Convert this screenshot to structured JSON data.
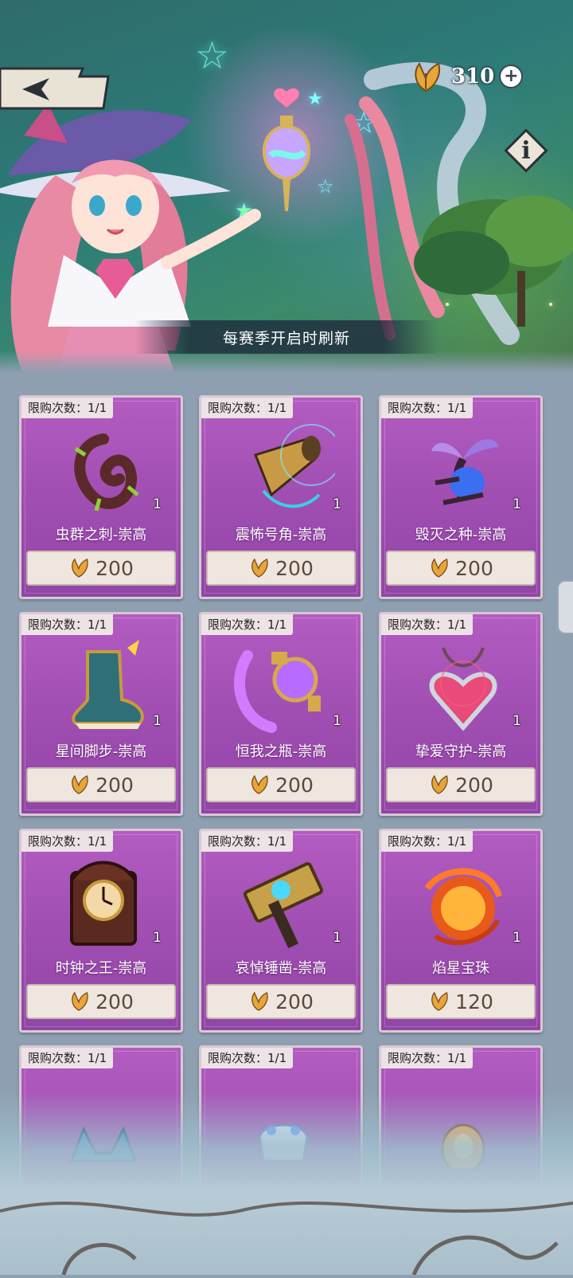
{
  "header": {
    "currency_amount": "310",
    "plus_label": "+",
    "info_label": "i",
    "refresh_note": "每赛季开启时刷新"
  },
  "colors": {
    "card_bg": "#a04eb2",
    "price_bg": "#efe6e0",
    "price_text": "#5a4a3b"
  },
  "shop": {
    "items": [
      {
        "limit": "限购次数：1/1",
        "name": "虫群之刺-崇高",
        "qty": "1",
        "price": "200",
        "icon": "thorn-icon"
      },
      {
        "limit": "限购次数：1/1",
        "name": "震怖号角-崇高",
        "qty": "1",
        "price": "200",
        "icon": "horn-icon"
      },
      {
        "limit": "限购次数：1/1",
        "name": "毁灭之种-崇高",
        "qty": "1",
        "price": "200",
        "icon": "seed-icon"
      },
      {
        "limit": "限购次数：1/1",
        "name": "星间脚步-崇高",
        "qty": "1",
        "price": "200",
        "icon": "boot-icon"
      },
      {
        "limit": "限购次数：1/1",
        "name": "恒我之瓶-崇高",
        "qty": "1",
        "price": "200",
        "icon": "bottle-icon"
      },
      {
        "limit": "限购次数：1/1",
        "name": "挚爱守护-崇高",
        "qty": "1",
        "price": "200",
        "icon": "heart-amulet-icon"
      },
      {
        "limit": "限购次数：1/1",
        "name": "时钟之王-崇高",
        "qty": "1",
        "price": "200",
        "icon": "clock-icon"
      },
      {
        "limit": "限购次数：1/1",
        "name": "哀悼锤凿-崇高",
        "qty": "1",
        "price": "200",
        "icon": "hammer-icon"
      },
      {
        "limit": "限购次数：1/1",
        "name": "焰星宝珠",
        "qty": "1",
        "price": "120",
        "icon": "fire-orb-icon"
      },
      {
        "limit": "限购次数：1/1",
        "icon": "crystal-cat-icon"
      },
      {
        "limit": "限购次数：1/1",
        "icon": "crystal-crown-icon"
      },
      {
        "limit": "限购次数：1/1",
        "icon": "fire-egg-icon"
      }
    ]
  }
}
